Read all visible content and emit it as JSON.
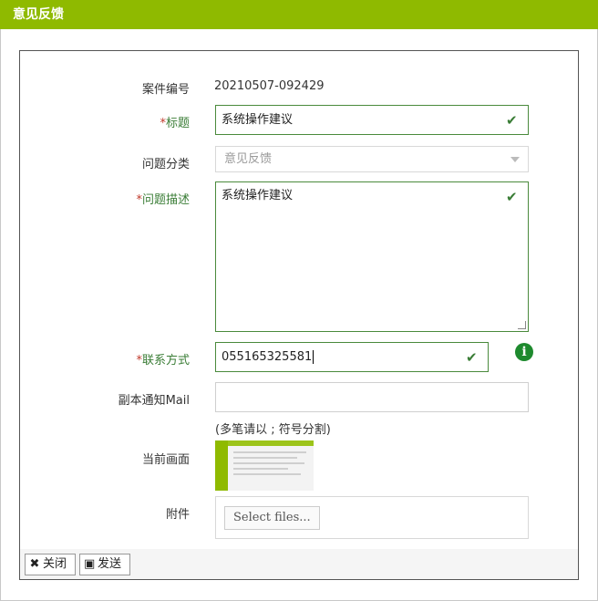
{
  "window": {
    "title": "意见反馈"
  },
  "form": {
    "case_no": {
      "label": "案件编号",
      "value": "20210507-092429"
    },
    "title": {
      "label": "标题",
      "value": "系统操作建议"
    },
    "category": {
      "label": "问题分类",
      "value": "意见反馈"
    },
    "description": {
      "label": "问题描述",
      "value": "系统操作建议"
    },
    "contact": {
      "label": "联系方式",
      "value": "055165325581"
    },
    "cc_mail": {
      "label": "副本通知Mail",
      "value": "",
      "hint": "(多笔请以 ; 符号分割)"
    },
    "screenshot": {
      "label": "当前画面"
    },
    "attachment": {
      "label": "附件",
      "button": "Select files..."
    }
  },
  "required_mark": "*",
  "footer": {
    "close_label": "关闭",
    "send_label": "发送"
  },
  "colors": {
    "titlebar": "#8fba00",
    "required_label": "#3a7d36",
    "check": "#3a7d36",
    "info": "#1e8a2e"
  }
}
